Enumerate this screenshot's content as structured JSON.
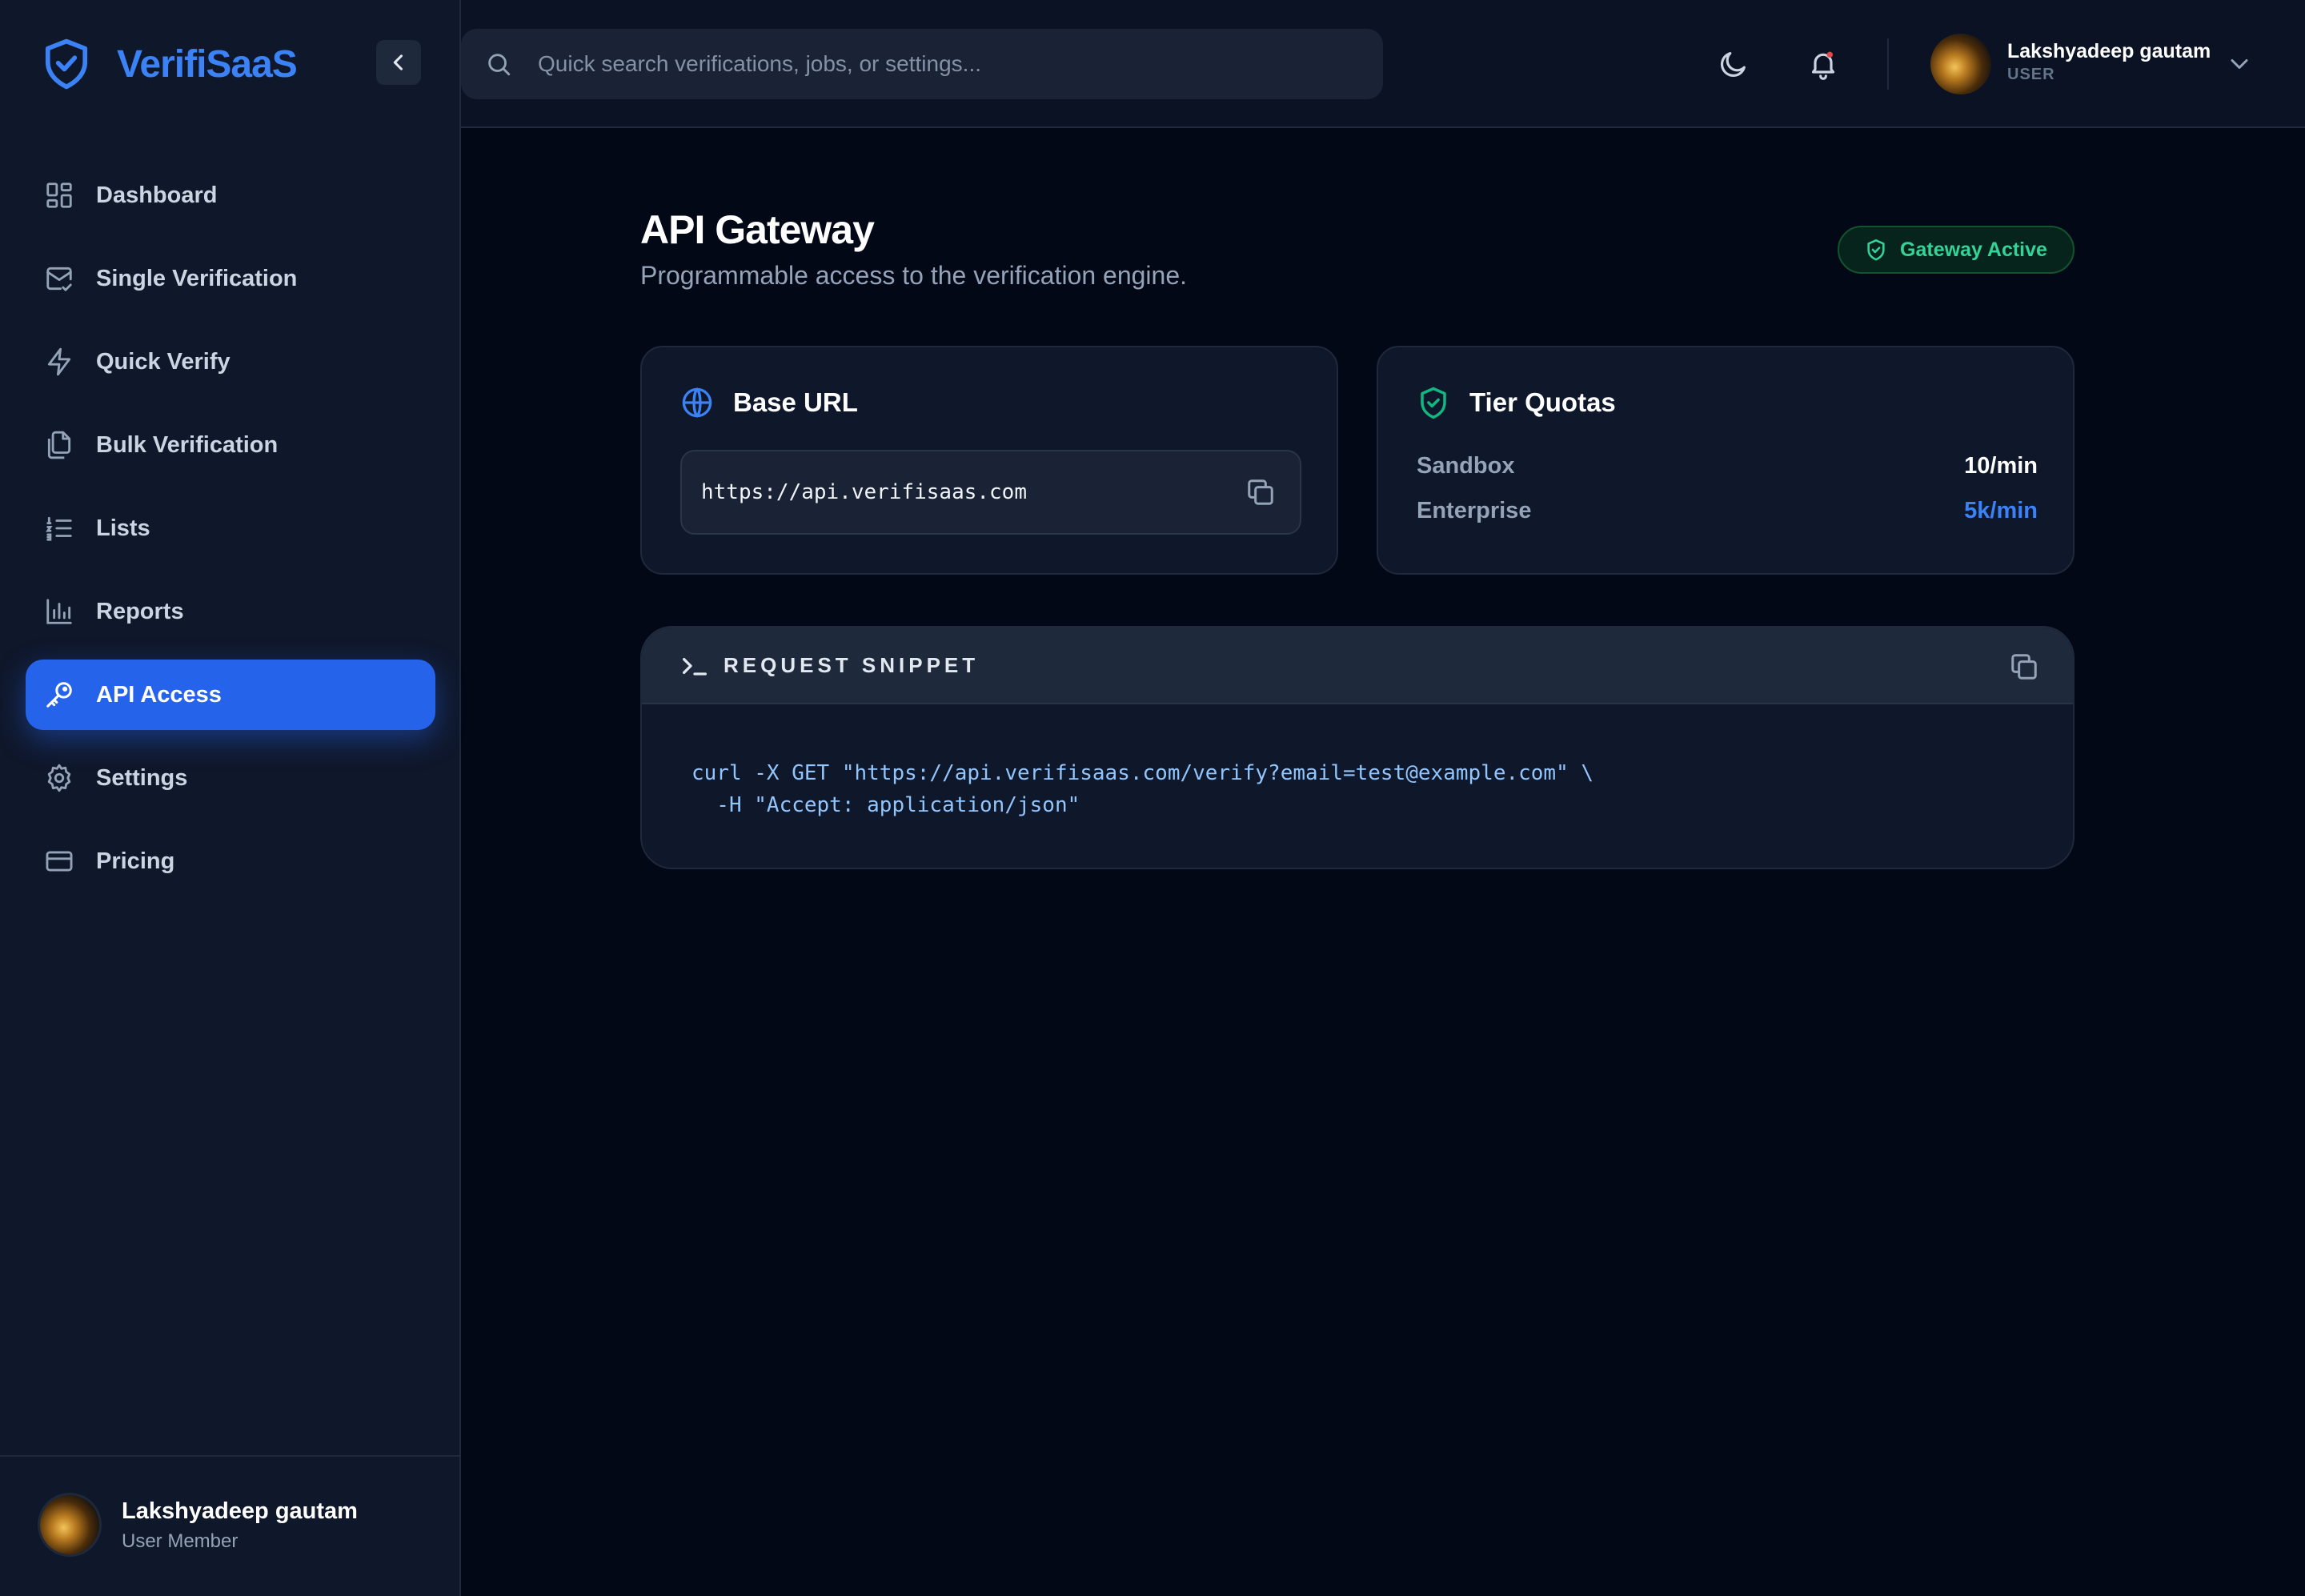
{
  "brand": {
    "name": "VerifiSaaS"
  },
  "sidebar": {
    "items": [
      {
        "label": "Dashboard",
        "icon": "grid-icon",
        "active": false
      },
      {
        "label": "Single Verification",
        "icon": "mail-check-icon",
        "active": false
      },
      {
        "label": "Quick Verify",
        "icon": "lightning-icon",
        "active": false
      },
      {
        "label": "Bulk Verification",
        "icon": "files-icon",
        "active": false
      },
      {
        "label": "Lists",
        "icon": "list-ordered-icon",
        "active": false
      },
      {
        "label": "Reports",
        "icon": "bar-chart-icon",
        "active": false
      },
      {
        "label": "API Access",
        "icon": "key-icon",
        "active": true
      },
      {
        "label": "Settings",
        "icon": "gear-icon",
        "active": false
      },
      {
        "label": "Pricing",
        "icon": "credit-card-icon",
        "active": false
      }
    ],
    "footer": {
      "name": "Lakshyadeep gautam",
      "role": "User Member"
    }
  },
  "topbar": {
    "search_placeholder": "Quick search verifications, jobs, or settings...",
    "user_name": "Lakshyadeep gautam",
    "user_role": "USER"
  },
  "page": {
    "title": "API Gateway",
    "subtitle": "Programmable access to the verification engine.",
    "status": "Gateway Active"
  },
  "base_url": {
    "title": "Base URL",
    "value": "https://api.verifisaas.com"
  },
  "tier_quotas": {
    "title": "Tier Quotas",
    "rows": [
      {
        "name": "Sandbox",
        "value": "10/min",
        "color": "#ffffff"
      },
      {
        "name": "Enterprise",
        "value": "5k/min",
        "color": "#3b82f6"
      }
    ]
  },
  "snippet": {
    "title": "REQUEST SNIPPET",
    "code": "curl -X GET \"https://api.verifisaas.com/verify?email=test@example.com\" \\\n  -H \"Accept: application/json\""
  },
  "colors": {
    "accent": "#2563eb",
    "success": "#34d399",
    "background": "#030817",
    "panel": "#0f172a"
  }
}
